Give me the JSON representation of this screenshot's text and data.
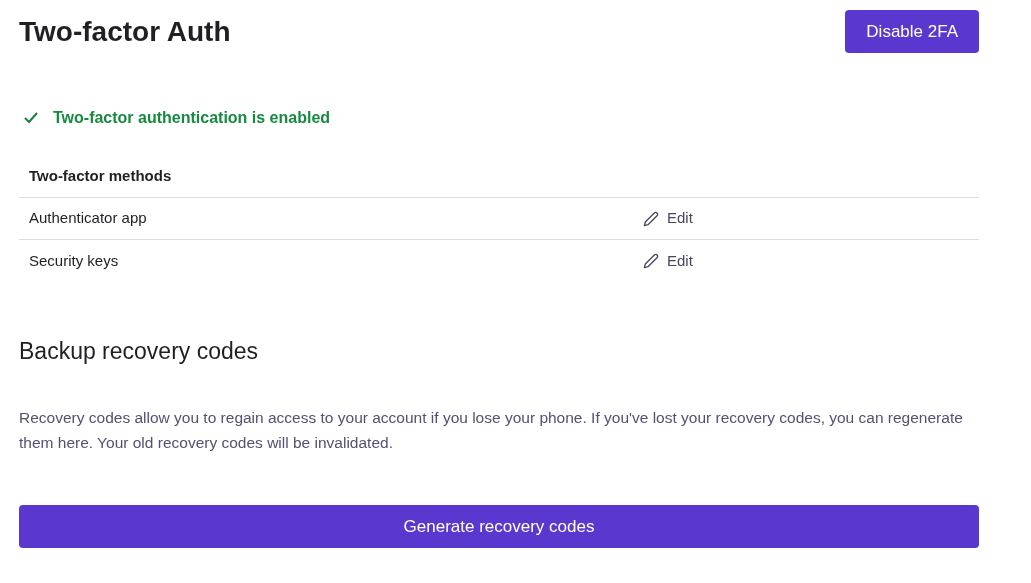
{
  "title": "Two-factor Auth",
  "disable_button": "Disable 2FA",
  "status": {
    "text": "Two-factor authentication is enabled",
    "enabled": true
  },
  "methods": {
    "heading": "Two-factor methods",
    "rows": [
      {
        "name": "Authenticator app",
        "action": "Edit"
      },
      {
        "name": "Security keys",
        "action": "Edit"
      }
    ]
  },
  "backup": {
    "heading": "Backup recovery codes",
    "description": "Recovery codes allow you to regain access to your account if you lose your phone. If you've lost your recovery codes, you can regenerate them here. Your old recovery codes will be invalidated.",
    "button": "Generate recovery codes"
  }
}
